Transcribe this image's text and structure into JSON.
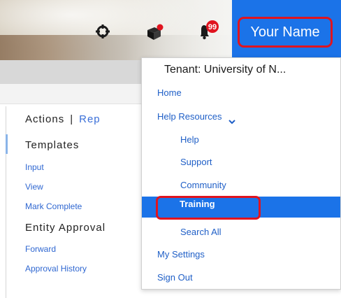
{
  "header": {
    "user_name": "Your Name",
    "notification_count": "99",
    "accent_color": "#1b73e8",
    "highlight_border_color": "#e0141f",
    "icons": [
      "crosshair-icon",
      "box-icon",
      "bell-icon"
    ]
  },
  "left_panel": {
    "actions_label": "Actions",
    "separator": "|",
    "reports_label": "Rep",
    "templates_heading": "Templates",
    "templates_links": [
      "Input",
      "View",
      "Mark Complete"
    ],
    "entity_approval_heading": "Entity Approval",
    "approval_links": [
      "Forward",
      "Approval History"
    ]
  },
  "dropdown": {
    "tenant_label": "Tenant: University of N...",
    "items": [
      {
        "label": "Home",
        "level": 0
      },
      {
        "label": "Help Resources",
        "level": 0,
        "has_chevron": true
      },
      {
        "label": "Help",
        "level": 1
      },
      {
        "label": "Support",
        "level": 1
      },
      {
        "label": "Community",
        "level": 1
      },
      {
        "label": "Training",
        "level": 1,
        "selected": true
      },
      {
        "label": "Search All",
        "level": 1
      },
      {
        "label": "My Settings",
        "level": 0
      },
      {
        "label": "Sign Out",
        "level": 0
      }
    ]
  }
}
